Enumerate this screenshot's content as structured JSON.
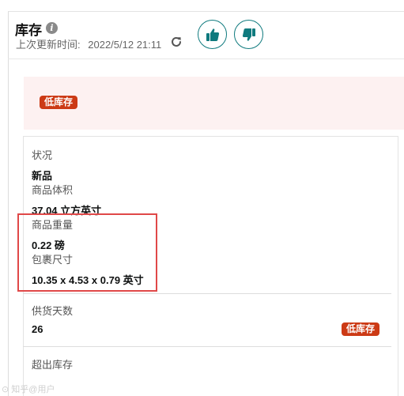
{
  "header": {
    "title": "库存",
    "info_icon": "info-icon",
    "updated_label": "上次更新时间:",
    "updated_time": "2022/5/12 21:11",
    "refresh_icon": "refresh-icon",
    "thumbs_up_icon": "thumbs-up-icon",
    "thumbs_down_icon": "thumbs-down-icon"
  },
  "alert": {
    "badge": "低库存",
    "badge_color": "#cc3a15",
    "background": "#fdf1f1"
  },
  "details": {
    "status_label": "状况",
    "status_value": "新品",
    "volume_label": "商品体积",
    "volume_value": "37.04 立方英寸",
    "weight_label": "商品重量",
    "weight_value": "0.22 磅",
    "package_label": "包裹尺寸",
    "package_value": "10.35 x 4.53 x 0.79 英寸",
    "supply_days_label": "供货天数",
    "supply_days_value": "26",
    "supply_badge": "低库存",
    "excess_label": "超出库存"
  },
  "highlight_color": "#e04848",
  "accent_color": "#0f7a7e",
  "watermark": "⊙ 知乎@用户"
}
